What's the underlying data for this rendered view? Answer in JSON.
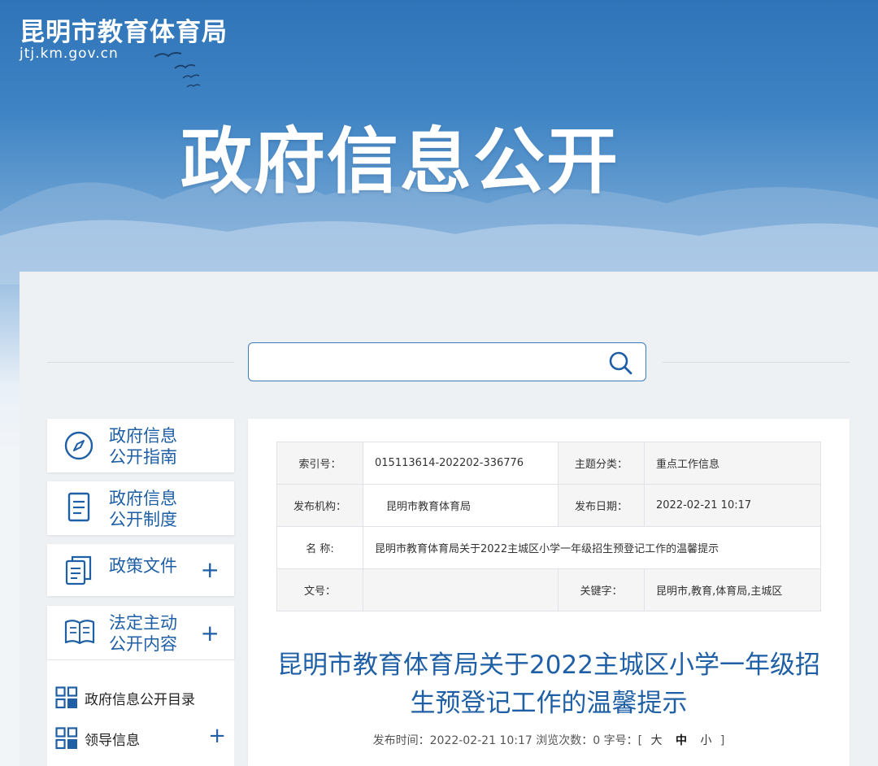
{
  "site": {
    "name": "昆明市教育体育局",
    "domain": "jtj.km.gov.cn",
    "banner_title": "政府信息公开"
  },
  "search": {
    "placeholder": "",
    "value": ""
  },
  "nav": {
    "cards": [
      {
        "line1": "政府信息",
        "line2": "公开指南",
        "icon": "compass-icon",
        "expandable": false
      },
      {
        "line1": "政府信息",
        "line2": "公开制度",
        "icon": "document-icon",
        "expandable": false
      },
      {
        "line1": "政策文件",
        "line2": "",
        "icon": "files-icon",
        "expandable": true,
        "plus": "+"
      },
      {
        "line1": "法定主动",
        "line2": "公开内容",
        "icon": "book-icon",
        "expandable": true,
        "plus": "+"
      }
    ],
    "sub_items": [
      {
        "label": "政府信息公开目录",
        "icon": "grid-icon",
        "plus": ""
      },
      {
        "label": "领导信息",
        "icon": "grid-icon",
        "plus": "+"
      }
    ]
  },
  "meta": {
    "index_label": "索引号：",
    "index_value": "015113614-202202-336776",
    "topic_label": "主题分类：",
    "topic_value": "重点工作信息",
    "org_label": "发布机构：",
    "org_value": "昆明市教育体育局",
    "date_label": "发布日期：",
    "date_value": "2022-02-21 10:17",
    "name_label": "名  称:",
    "name_value": "昆明市教育体育局关于2022主城区小学一年级招生预登记工作的温馨提示",
    "docno_label": "文号：",
    "docno_value": "",
    "keyword_label": "关键字：",
    "keyword_value": "昆明市,教育,体育局,主城区"
  },
  "article": {
    "title": "昆明市教育体育局关于2022主城区小学一年级招生预登记工作的温馨提示",
    "publish_prefix": "发布时间：",
    "publish_time": "2022-02-21 10:17",
    "views_prefix": "浏览次数：",
    "views": "0",
    "fontsize_prefix": "字号：[",
    "fontsize_large": "大",
    "fontsize_medium": "中",
    "fontsize_small": "小",
    "fontsize_suffix": "]"
  },
  "colors": {
    "accent": "#1e5fa5",
    "banner": "#2f74b8"
  }
}
